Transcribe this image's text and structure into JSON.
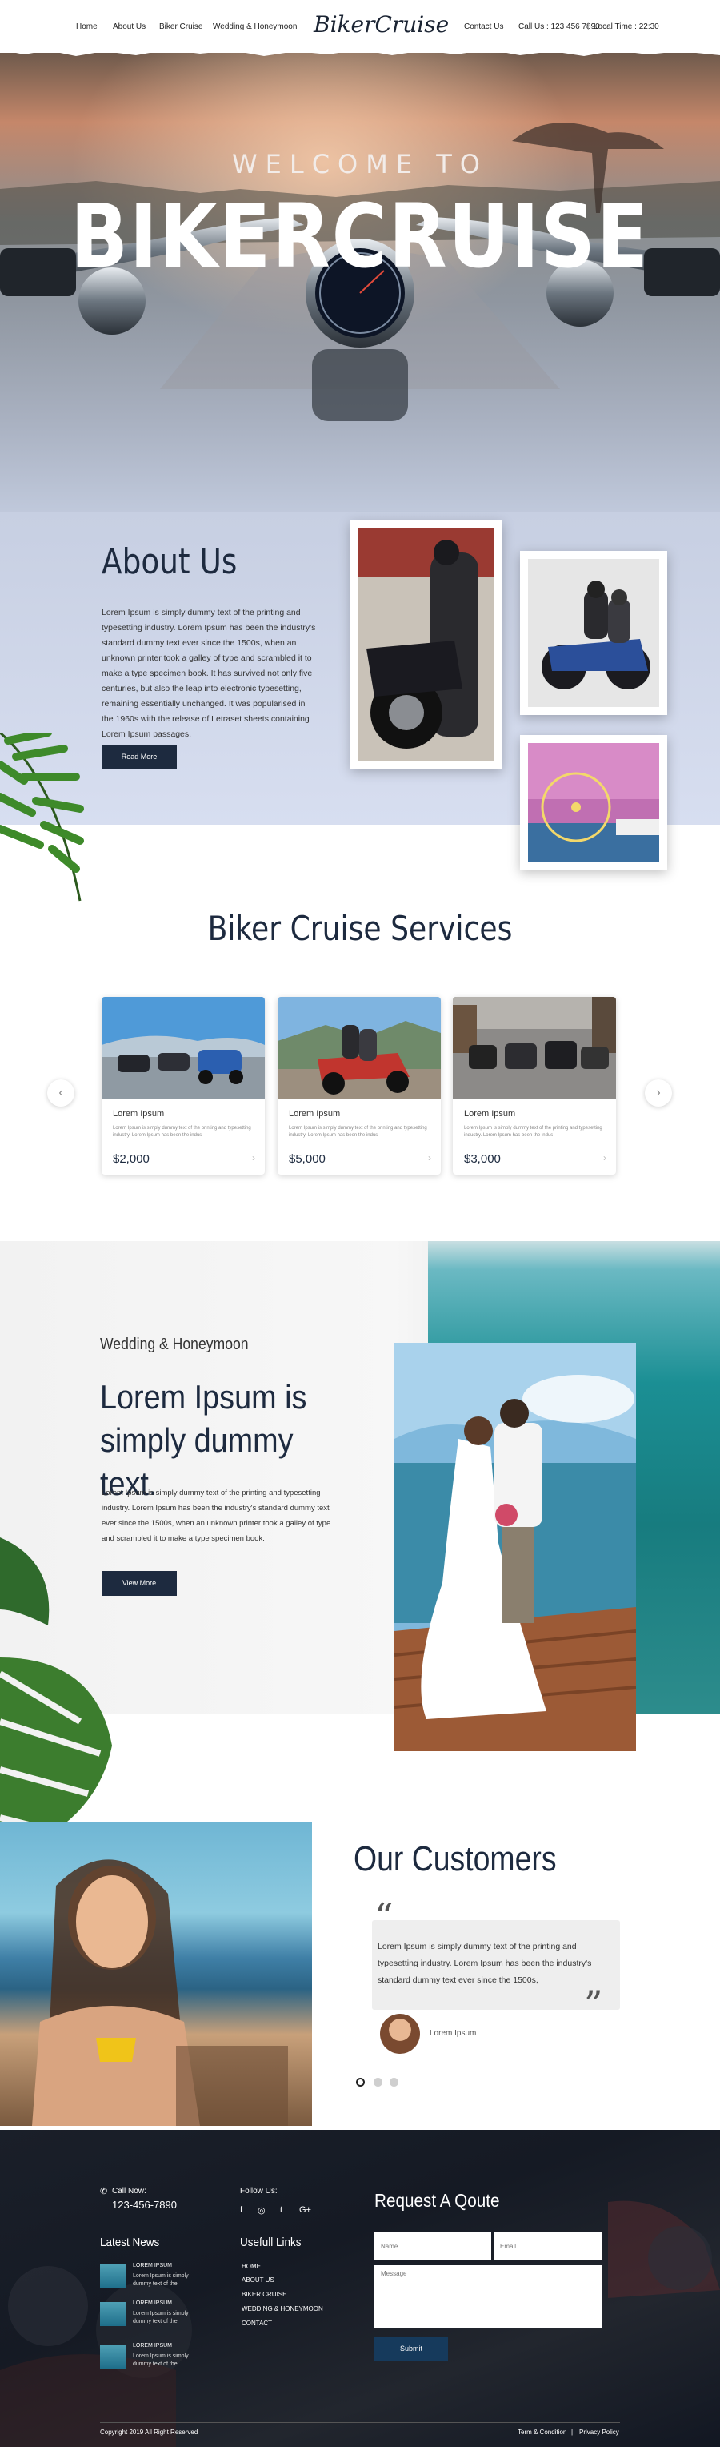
{
  "nav": {
    "left": [
      "Home",
      "About Us",
      "Biker Cruise",
      "Wedding & Honeymoon"
    ],
    "logo": "BikerCruise",
    "right": [
      "Contact Us",
      "Call Us : 123 456 7890",
      "|",
      "Local Time : 22:30"
    ]
  },
  "hero": {
    "welcome": "WELCOME TO",
    "title": "BIKERCRUISE"
  },
  "about": {
    "title": "About Us",
    "text": "Lorem Ipsum is simply dummy text of the printing and typesetting industry. Lorem Ipsum has been the industry's standard dummy text ever since the 1500s, when an unknown printer took a galley of type and scrambled it to make a type specimen book. It has survived not only five centuries, but also the leap into electronic typesetting, remaining essentially unchanged. It was popularised in the 1960s with the release of Letraset sheets containing Lorem Ipsum passages,",
    "button": "Read More"
  },
  "services": {
    "title": "Biker Cruise Services",
    "cards": [
      {
        "title": "Lorem Ipsum",
        "desc": "Lorem Ipsum is simply dummy text of the printing and typesetting industry. Lorem Ipsum has been the indus",
        "price": "$2,000",
        "arrow": "›"
      },
      {
        "title": "Lorem Ipsum",
        "desc": "Lorem Ipsum is simply dummy text of the printing and typesetting industry. Lorem Ipsum has been the indus",
        "price": "$5,000",
        "arrow": "›"
      },
      {
        "title": "Lorem Ipsum",
        "desc": "Lorem Ipsum is simply dummy text of the printing and typesetting industry. Lorem Ipsum has been the indus",
        "price": "$3,000",
        "arrow": "›"
      }
    ],
    "prev": "‹",
    "next": "›"
  },
  "wedding": {
    "subtitle": "Wedding & Honeymoon",
    "title": "Lorem Ipsum is simply dummy text.",
    "text": "Lorem Ipsum is simply dummy text of the printing and typesetting industry. Lorem Ipsum has been the industry's standard dummy text ever since the 1500s, when an unknown printer took a galley of type and scrambled it to make a type specimen book.",
    "button": "View More"
  },
  "customers": {
    "title": "Our Customers",
    "quote": "Lorem Ipsum is simply dummy text of the printing and typesetting industry. Lorem Ipsum has been the industry's standard dummy text ever since the 1500s,",
    "author": "Lorem Ipsum",
    "open_quote": "“",
    "close_quote": "”"
  },
  "footer": {
    "call_label": "Call Now:",
    "phone": "123-456-7890",
    "follow": "Follow Us:",
    "social": [
      "f",
      "◎",
      "t",
      "G+"
    ],
    "latest_news": "Latest News",
    "news": [
      {
        "title": "LOREM IPSUM",
        "text": "Lorem Ipsum is simply dummy text of the."
      },
      {
        "title": "LOREM IPSUM",
        "text": "Lorem Ipsum is simply dummy text of the."
      },
      {
        "title": "LOREM IPSUM",
        "text": "Lorem Ipsum is simply dummy text of the."
      }
    ],
    "useful_links": "Usefull Links",
    "links": [
      "HOME",
      "ABOUT US",
      "BIKER CRUISE",
      "WEDDING & HONEYMOON",
      "CONTACT"
    ],
    "form_title": "Request A Qoute",
    "name_ph": "Name",
    "email_ph": "Email",
    "message_ph": "Message",
    "submit": "Submit",
    "copyright": "Copyright  2019   All Right Reserved",
    "terms": "Term & Condition",
    "sep": "|",
    "privacy": "Privacy Policy"
  },
  "colors": {
    "navy": "#1d2a3f",
    "accent_teal": "#1b8f94"
  }
}
